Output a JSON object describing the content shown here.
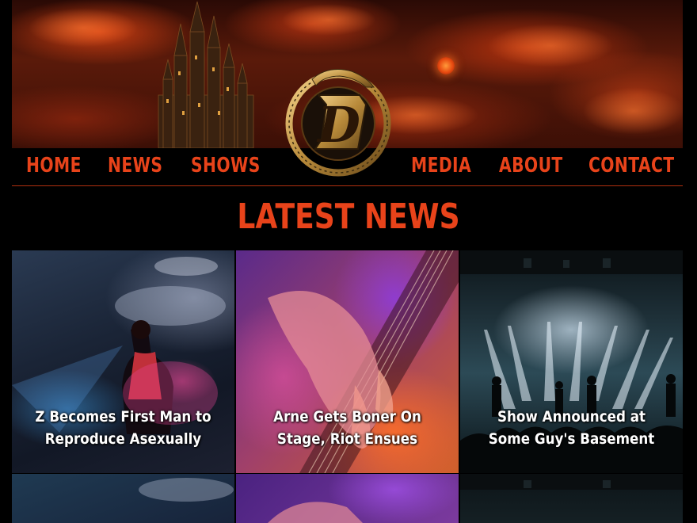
{
  "nav": {
    "items": [
      "HOME",
      "NEWS",
      "SHOWS",
      "MEDIA",
      "ABOUT",
      "CONTACT"
    ]
  },
  "logo": {
    "letter": "D"
  },
  "section": {
    "title": "LATEST NEWS"
  },
  "news": [
    {
      "title": "Z Becomes First Man to Reproduce Asexually"
    },
    {
      "title": "Arne Gets Boner On Stage, Riot Ensues"
    },
    {
      "title": "Show Announced at Some Guy's Basement"
    }
  ],
  "colors": {
    "accent": "#e8431a",
    "background": "#000000"
  }
}
